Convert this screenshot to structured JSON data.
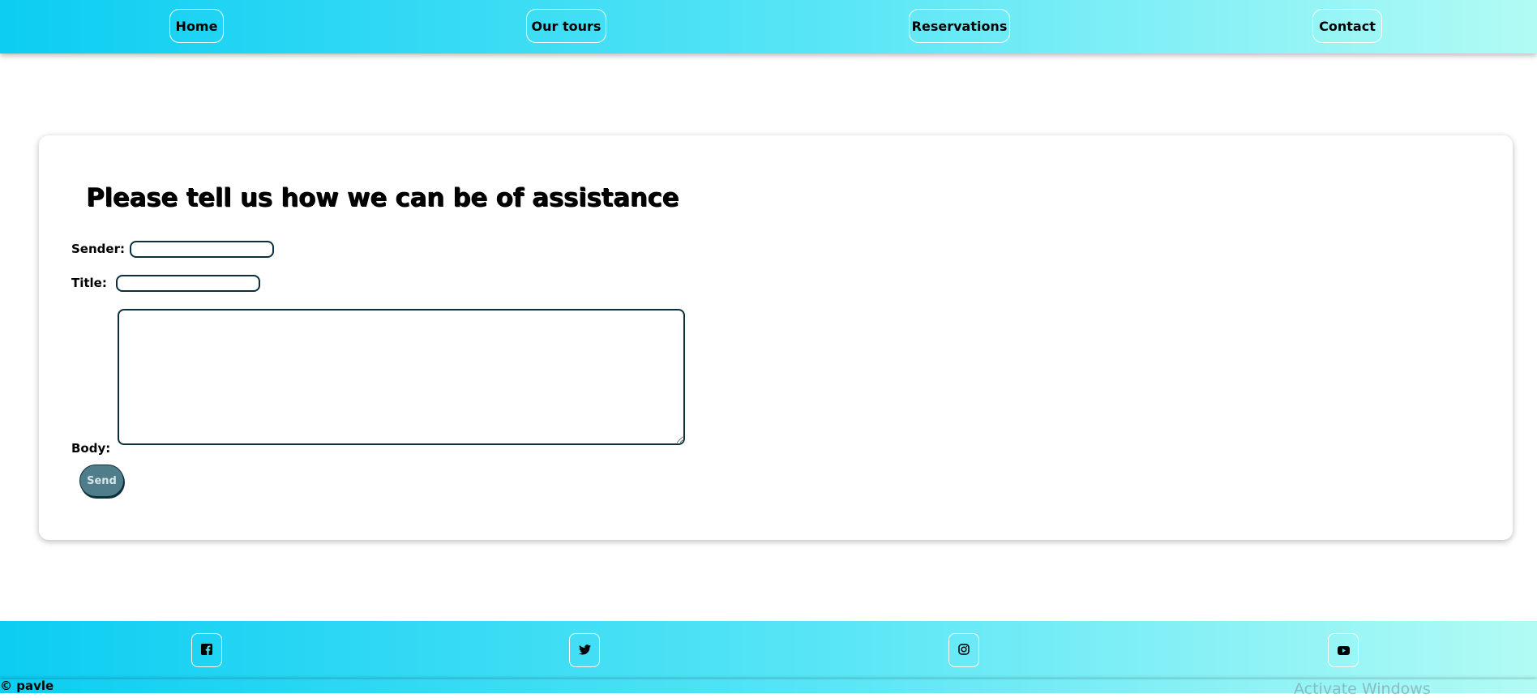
{
  "nav": {
    "items": [
      {
        "label": "Home"
      },
      {
        "label": "Our tours"
      },
      {
        "label": "Reservations"
      },
      {
        "label": "Contact"
      }
    ]
  },
  "form": {
    "heading": "Please tell us how we can be of assistance",
    "sender_label": "Sender:",
    "sender_value": "",
    "title_label": "Title:",
    "title_value": "",
    "body_label": "Body:",
    "body_value": "",
    "send_label": "Send"
  },
  "footer": {
    "social": [
      {
        "icon": "facebook-icon"
      },
      {
        "icon": "twitter-icon"
      },
      {
        "icon": "instagram-icon"
      },
      {
        "icon": "youtube-icon"
      }
    ],
    "copyright": "© pavle"
  },
  "overlay": {
    "watermark": "Activate Windows"
  },
  "colors": {
    "gradient_start": "#0ccdf2",
    "gradient_end": "#b2fbf5",
    "input_border": "#0b2f3c",
    "send_button": "#4f7d89"
  }
}
